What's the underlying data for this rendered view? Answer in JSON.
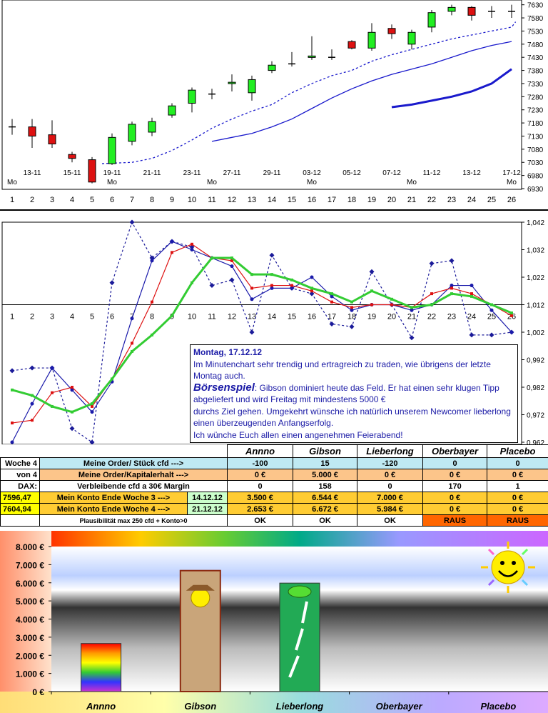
{
  "chart_data": [
    {
      "type": "candlestick",
      "x": [
        1,
        2,
        3,
        4,
        5,
        6,
        7,
        8,
        9,
        10,
        11,
        12,
        13,
        14,
        15,
        16,
        17,
        18,
        19,
        20,
        21,
        22,
        23,
        24,
        25,
        26
      ],
      "x_tick_labels": [
        "1",
        "2",
        "3",
        "4",
        "5",
        "6",
        "7",
        "8",
        "9",
        "10",
        "11",
        "12",
        "13",
        "14",
        "15",
        "16",
        "17",
        "18",
        "19",
        "20",
        "21",
        "22",
        "23",
        "24",
        "25",
        "26"
      ],
      "date_labels": [
        {
          "x": 2,
          "label": "13-11"
        },
        {
          "x": 4,
          "label": "15-11"
        },
        {
          "x": 6,
          "label": "19-11"
        },
        {
          "x": 8,
          "label": "21-11"
        },
        {
          "x": 10,
          "label": "23-11"
        },
        {
          "x": 12,
          "label": "27-11"
        },
        {
          "x": 14,
          "label": "29-11"
        },
        {
          "x": 16,
          "label": "03-12"
        },
        {
          "x": 18,
          "label": "05-12"
        },
        {
          "x": 20,
          "label": "07-12"
        },
        {
          "x": 22,
          "label": "11-12"
        },
        {
          "x": 24,
          "label": "13-12"
        },
        {
          "x": 26,
          "label": "17-12"
        }
      ],
      "monday_marks": [
        {
          "x": 1,
          "label": "Mo"
        },
        {
          "x": 6,
          "label": "Mo"
        },
        {
          "x": 11,
          "label": "Mo"
        },
        {
          "x": 16,
          "label": "Mo"
        },
        {
          "x": 21,
          "label": "Mo"
        },
        {
          "x": 26,
          "label": "Mo"
        }
      ],
      "candles": [
        {
          "x": 1,
          "o": 7165,
          "h": 7195,
          "l": 7135,
          "c": 7165
        },
        {
          "x": 2,
          "o": 7165,
          "h": 7195,
          "l": 7085,
          "c": 7130
        },
        {
          "x": 3,
          "o": 7135,
          "h": 7190,
          "l": 7085,
          "c": 7100
        },
        {
          "x": 4,
          "o": 7060,
          "h": 7070,
          "l": 7030,
          "c": 7045
        },
        {
          "x": 5,
          "o": 7040,
          "h": 7050,
          "l": 6950,
          "c": 6955
        },
        {
          "x": 6,
          "o": 7025,
          "h": 7140,
          "l": 7020,
          "c": 7125
        },
        {
          "x": 7,
          "o": 7110,
          "h": 7185,
          "l": 7095,
          "c": 7175
        },
        {
          "x": 8,
          "o": 7145,
          "h": 7200,
          "l": 7130,
          "c": 7185
        },
        {
          "x": 9,
          "o": 7210,
          "h": 7255,
          "l": 7200,
          "c": 7245
        },
        {
          "x": 10,
          "o": 7255,
          "h": 7315,
          "l": 7220,
          "c": 7305
        },
        {
          "x": 11,
          "o": 7290,
          "h": 7310,
          "l": 7270,
          "c": 7290
        },
        {
          "x": 12,
          "o": 7330,
          "h": 7365,
          "l": 7300,
          "c": 7335
        },
        {
          "x": 13,
          "o": 7295,
          "h": 7360,
          "l": 7265,
          "c": 7345
        },
        {
          "x": 14,
          "o": 7380,
          "h": 7415,
          "l": 7370,
          "c": 7400
        },
        {
          "x": 15,
          "o": 7405,
          "h": 7450,
          "l": 7395,
          "c": 7405
        },
        {
          "x": 16,
          "o": 7430,
          "h": 7510,
          "l": 7420,
          "c": 7435
        },
        {
          "x": 17,
          "o": 7430,
          "h": 7460,
          "l": 7420,
          "c": 7430
        },
        {
          "x": 18,
          "o": 7490,
          "h": 7495,
          "l": 7460,
          "c": 7465
        },
        {
          "x": 19,
          "o": 7465,
          "h": 7560,
          "l": 7455,
          "c": 7525
        },
        {
          "x": 20,
          "o": 7540,
          "h": 7555,
          "l": 7500,
          "c": 7520
        },
        {
          "x": 21,
          "o": 7480,
          "h": 7535,
          "l": 7460,
          "c": 7525
        },
        {
          "x": 22,
          "o": 7545,
          "h": 7610,
          "l": 7525,
          "c": 7600
        },
        {
          "x": 23,
          "o": 7605,
          "h": 7630,
          "l": 7590,
          "c": 7620
        },
        {
          "x": 24,
          "o": 7620,
          "h": 7625,
          "l": 7570,
          "c": 7590
        },
        {
          "x": 25,
          "o": 7605,
          "h": 7625,
          "l": 7580,
          "c": 7605
        },
        {
          "x": 26,
          "o": 7605,
          "h": 7630,
          "l": 7580,
          "c": 7605
        }
      ],
      "series": [
        {
          "style": "dashed",
          "color": "#1a1acc",
          "values": [
            [
              5.5,
              7025
            ],
            [
              7,
              7030
            ],
            [
              8,
              7045
            ],
            [
              9,
              7075
            ],
            [
              10,
              7115
            ],
            [
              11,
              7160
            ],
            [
              12,
              7195
            ],
            [
              13,
              7225
            ],
            [
              14,
              7250
            ],
            [
              15,
              7295
            ],
            [
              16,
              7330
            ],
            [
              17,
              7360
            ],
            [
              18,
              7380
            ],
            [
              19,
              7415
            ],
            [
              20,
              7440
            ],
            [
              21,
              7460
            ],
            [
              22,
              7480
            ],
            [
              23,
              7500
            ],
            [
              24,
              7515
            ],
            [
              25,
              7530
            ],
            [
              26,
              7545
            ],
            [
              26.2,
              7565
            ]
          ]
        },
        {
          "style": "solid",
          "color": "#1a1acc",
          "values": [
            [
              11,
              7110
            ],
            [
              12,
              7125
            ],
            [
              13,
              7140
            ],
            [
              14,
              7165
            ],
            [
              15,
              7195
            ],
            [
              16,
              7235
            ],
            [
              17,
              7275
            ],
            [
              18,
              7310
            ],
            [
              19,
              7340
            ],
            [
              20,
              7365
            ],
            [
              21,
              7385
            ],
            [
              22,
              7405
            ],
            [
              23,
              7430
            ],
            [
              24,
              7455
            ],
            [
              25,
              7475
            ],
            [
              26,
              7490
            ]
          ]
        },
        {
          "style": "thick",
          "color": "#1a1acc",
          "values": [
            [
              20,
              7240
            ],
            [
              21,
              7250
            ],
            [
              22,
              7265
            ],
            [
              23,
              7280
            ],
            [
              24,
              7300
            ],
            [
              25,
              7330
            ],
            [
              26,
              7385
            ]
          ]
        }
      ],
      "y_ticks": [
        6930,
        6980,
        7030,
        7080,
        7130,
        7180,
        7230,
        7280,
        7330,
        7380,
        7430,
        7480,
        7530,
        7580,
        7630
      ],
      "ylim": [
        6930,
        7640
      ],
      "xlim": [
        0.5,
        26.5
      ]
    },
    {
      "type": "line",
      "x": [
        1,
        2,
        3,
        4,
        5,
        6,
        7,
        8,
        9,
        10,
        11,
        12,
        13,
        14,
        15,
        16,
        17,
        18,
        19,
        20,
        21,
        22,
        23,
        24,
        25,
        26
      ],
      "x_tick_labels": [
        "1",
        "2",
        "3",
        "4",
        "5",
        "6",
        "7",
        "8",
        "9",
        "10",
        "11",
        "12",
        "13",
        "14",
        "15",
        "16",
        "17",
        "18",
        "19",
        "20",
        "21",
        "22",
        "23",
        "24",
        "25",
        "26"
      ],
      "series": [
        {
          "color": "#1a1a99",
          "style": "dashed",
          "marker": "diamond",
          "values": [
            0.988,
            0.989,
            0.989,
            0.967,
            0.962,
            1.02,
            1.042,
            1.029,
            1.035,
            1.033,
            1.019,
            1.021,
            1.002,
            1.03,
            1.018,
            1.016,
            1.005,
            1.004,
            1.024,
            1.012,
            1.0,
            1.027,
            1.028,
            1.001,
            1.001,
            1.002
          ]
        },
        {
          "color": "#1a1aaa",
          "style": "solid",
          "marker": "circle",
          "values": [
            0.962,
            0.976,
            0.989,
            0.981,
            0.973,
            0.984,
            1.007,
            1.028,
            1.035,
            1.032,
            1.029,
            1.026,
            1.014,
            1.018,
            1.018,
            1.022,
            1.015,
            1.01,
            1.012,
            1.012,
            1.01,
            1.012,
            1.019,
            1.019,
            1.01,
            1.002
          ]
        },
        {
          "color": "#dd1111",
          "style": "solid",
          "marker": "square",
          "values": [
            0.969,
            0.97,
            0.98,
            0.982,
            0.975,
            0.985,
            0.998,
            1.013,
            1.031,
            1.034,
            1.029,
            1.028,
            1.018,
            1.019,
            1.019,
            1.017,
            1.013,
            1.011,
            1.012,
            1.012,
            1.011,
            1.016,
            1.018,
            1.016,
            1.012,
            1.008
          ]
        },
        {
          "color": "#33cc33",
          "style": "thick",
          "marker": "square",
          "values": [
            0.981,
            0.979,
            0.975,
            0.973,
            0.976,
            0.985,
            0.995,
            1.001,
            1.008,
            1.02,
            1.029,
            1.029,
            1.023,
            1.023,
            1.021,
            1.018,
            1.016,
            1.013,
            1.017,
            1.014,
            1.011,
            1.012,
            1.016,
            1.015,
            1.012,
            1.009
          ]
        }
      ],
      "y_ticks": [
        "1,042",
        "1,032",
        "1,022",
        "1,012",
        "1,002",
        "0,992",
        "0,982",
        "0,972",
        "0,962"
      ],
      "y_tick_values": [
        1.042,
        1.032,
        1.022,
        1.012,
        1.002,
        0.992,
        0.982,
        0.972,
        0.962
      ],
      "baseline": 1.012,
      "ylim": [
        0.962,
        1.042
      ],
      "xlim": [
        0.5,
        26.5
      ]
    },
    {
      "type": "bar",
      "categories": [
        "Annno",
        "Gibson",
        "Lieberlong",
        "Oberbayer",
        "Placebo"
      ],
      "values": [
        2653,
        6672,
        5984,
        0,
        0
      ],
      "y_ticks": [
        "0 €",
        "1.000 €",
        "2.000 €",
        "3.000 €",
        "4.000 €",
        "5.000 €",
        "6.000 €",
        "7.000 €",
        "8.000 €"
      ],
      "ylim": [
        0,
        8000
      ]
    }
  ],
  "comment": {
    "date": "Montag, 17.12.12",
    "line1": "Im Minutenchart sehr trendig und ertragreich zu traden, wie übrigens der letzte Montag auch.",
    "brand": "Börsenspiel",
    "line2": ": Gibson dominiert heute das Feld. Er hat einen sehr klugen Tipp abgeliefert und wird Freitag mit mindestens 5000 €",
    "line3": "durchs Ziel gehen. Umgekehrt wünsche ich natürlich unserem Newcomer lieberlong einen überzeugenden Anfangserfolg.",
    "line4": "Ich wünche Euch allen einen angenehmen Feierabend!"
  },
  "table": {
    "players": [
      "Annno",
      "Gibson",
      "Lieberlong",
      "Oberbayer",
      "Placebo"
    ],
    "rows": [
      {
        "left": "Woche 4",
        "label": "Meine Order/ Stück cfd  --->",
        "values": [
          "-100",
          "15",
          "-120",
          "0",
          "0"
        ],
        "style": "blue"
      },
      {
        "left": "von 4",
        "label": "Meine Order/Kapitalerhalt  --->",
        "values": [
          "0 €",
          "5.000 €",
          "0 €",
          "0 €",
          "0 €"
        ],
        "style": "orange"
      },
      {
        "left": "DAX:",
        "label": "Verbleibende cfd a 30€ Margin",
        "values": [
          "0",
          "158",
          "0",
          "170",
          "1"
        ],
        "style": "white"
      },
      {
        "left": "7596,47",
        "label": "Mein Konto Ende Woche 3 --->",
        "date": "14.12.12",
        "values": [
          "3.500 €",
          "6.544 €",
          "7.000 €",
          "0 €",
          "0 €"
        ],
        "style": "gold"
      },
      {
        "left": "7604,94",
        "label": "Mein Konto Ende Woche 4 --->",
        "date": "21.12.12",
        "values": [
          "2.653 €",
          "6.672 €",
          "5.984 €",
          "0 €",
          "0 €"
        ],
        "style": "gold"
      },
      {
        "left": "",
        "label": "Plausibilität max 250 cfd + Konto>0",
        "values": [
          "OK",
          "OK",
          "OK",
          "RAUS",
          "RAUS"
        ],
        "style": "status"
      }
    ]
  },
  "colors": {
    "bull": "#22ee22",
    "bear": "#dd1111",
    "ma": "#1a1acc",
    "accent_gold": "#ffcc33",
    "raus": "#ff6600",
    "confirm_green": "#ccffcc"
  }
}
